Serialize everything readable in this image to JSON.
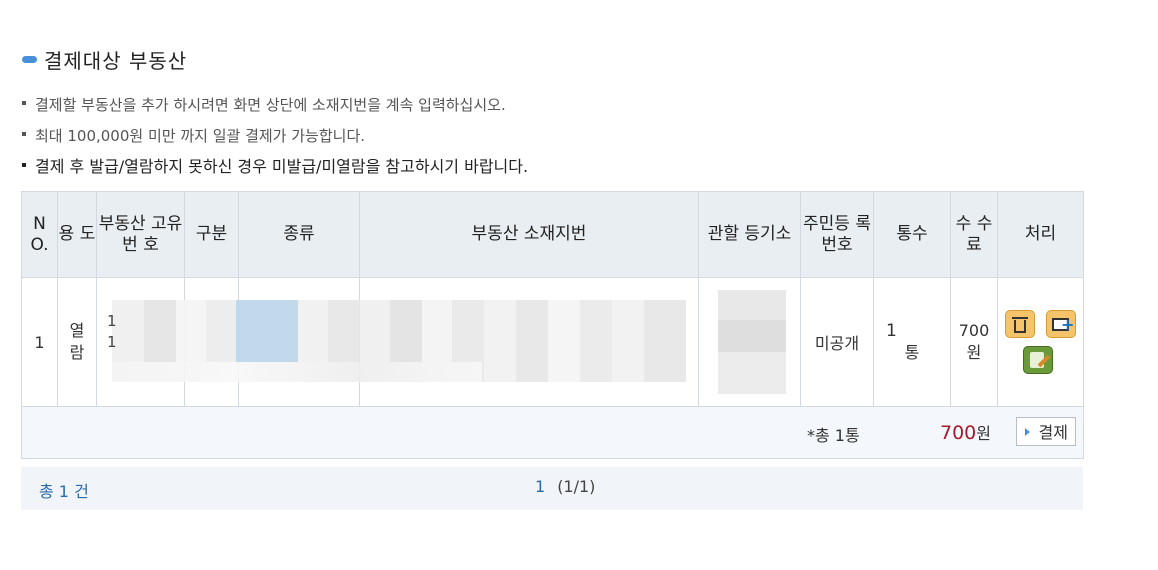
{
  "section": {
    "title": "결제대상 부동산"
  },
  "notes": [
    "결제할 부동산을 추가 하시려면 화면 상단에 소재지번을 계속 입력하십시오.",
    "최대 100,000원 미만 까지 일괄 결제가 가능합니다.",
    "결제 후 발급/열람하지 못하신 경우 미발급/미열람을 참고하시기 바랍니다."
  ],
  "table": {
    "headers": {
      "no": "N O.",
      "purpose": "용 도",
      "unique_no": "부동산 고유번 호",
      "division": "구분",
      "type": "종류",
      "address": "부동산 소재지번",
      "registry": "관할 등기소",
      "resident_no": "주민등 록번호",
      "copies": "통수",
      "fee": "수 수 료",
      "action": "처리"
    },
    "row": {
      "no": "1",
      "purpose": "열람",
      "unique_no_partial": [
        "1",
        "1"
      ],
      "resident_no": "미공개",
      "copies_num": "1",
      "copies_unit": "통",
      "fee_num": "700",
      "fee_unit": "원",
      "icons": [
        "trash-icon",
        "folder-add-icon",
        "edit-icon"
      ]
    },
    "summary": {
      "total_count": "*총 1통",
      "total_amount": "700",
      "total_unit": "원",
      "pay_button": "결제"
    }
  },
  "pager": {
    "count": "총 1 건",
    "current": "1",
    "pages": "(1/1)"
  },
  "colors": {
    "accent": "#4a90d9",
    "amount": "#a31b2c",
    "link": "#2c6aa8"
  }
}
